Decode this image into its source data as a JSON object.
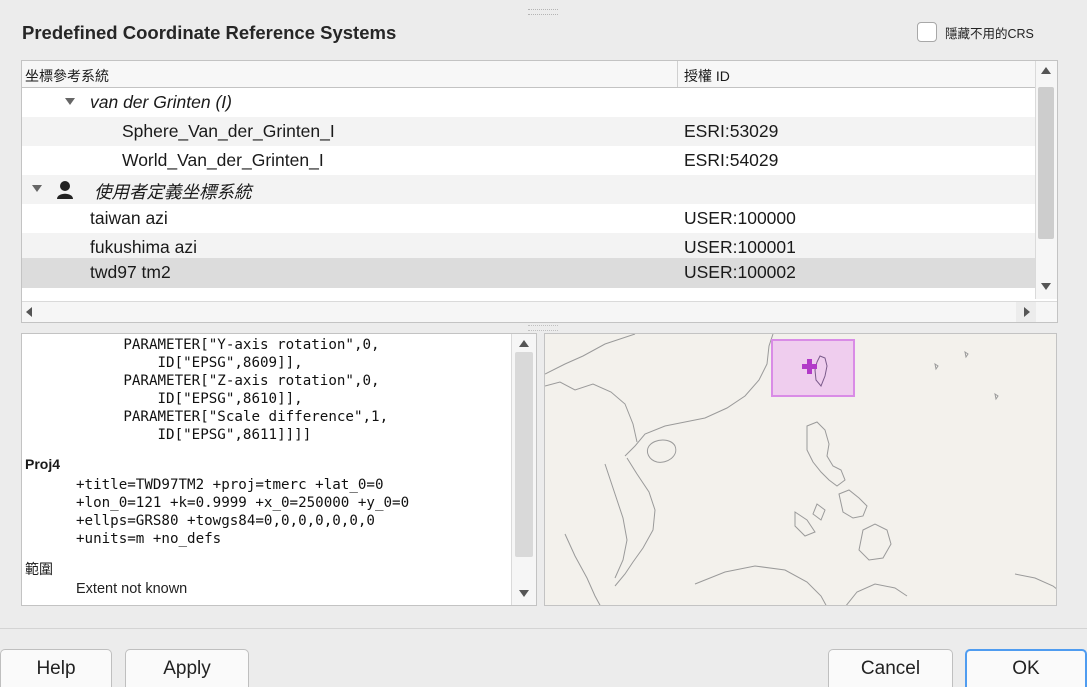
{
  "section": {
    "title": "Predefined Coordinate Reference Systems",
    "hide_deprecated_label": "隱藏不用的CRS"
  },
  "crs_table": {
    "columns": [
      "坐標參考系統",
      "授權 ID"
    ],
    "rows": [
      {
        "name": "van der Grinten (I)",
        "auth_id": "",
        "kind": "group"
      },
      {
        "name": "Sphere_Van_der_Grinten_I",
        "auth_id": "ESRI:53029",
        "kind": "item"
      },
      {
        "name": "World_Van_der_Grinten_I",
        "auth_id": "ESRI:54029",
        "kind": "item"
      },
      {
        "name": "使用者定義坐標系統",
        "auth_id": "",
        "kind": "group"
      },
      {
        "name": "taiwan azi",
        "auth_id": "USER:100000",
        "kind": "item"
      },
      {
        "name": "fukushima azi",
        "auth_id": "USER:100001",
        "kind": "item"
      },
      {
        "name": "twd97 tm2",
        "auth_id": "USER:100002",
        "kind": "item",
        "selected": true
      }
    ]
  },
  "wkt": {
    "lines": [
      "        PARAMETER[\"Y-axis rotation\",0,",
      "            ID[\"EPSG\",8609]],",
      "        PARAMETER[\"Z-axis rotation\",0,",
      "            ID[\"EPSG\",8610]],",
      "        PARAMETER[\"Scale difference\",1,",
      "            ID[\"EPSG\",8611]]]]"
    ],
    "proj4_heading": "Proj4",
    "proj4_lines": [
      "+title=TWD97TM2 +proj=tmerc +lat_0=0",
      "+lon_0=121 +k=0.9999 +x_0=250000 +y_0=0",
      "+ellps=GRS80 +towgs84=0,0,0,0,0,0,0",
      "+units=m +no_defs"
    ],
    "extent_heading": "範圍",
    "extent_value": "Extent not known"
  },
  "buttons": {
    "help": "Help",
    "apply": "Apply",
    "cancel": "Cancel",
    "ok": "OK"
  },
  "icons": {
    "tree_expanded": "triangle-down-icon",
    "user_group": "person-icon",
    "map_marker": "crosshair-plus-icon"
  },
  "colors": {
    "selected_row": "#dcdcdc",
    "extent_highlight": "#e9a8ef",
    "marker": "#b23ac8",
    "ok_border": "#4f9cf0"
  }
}
